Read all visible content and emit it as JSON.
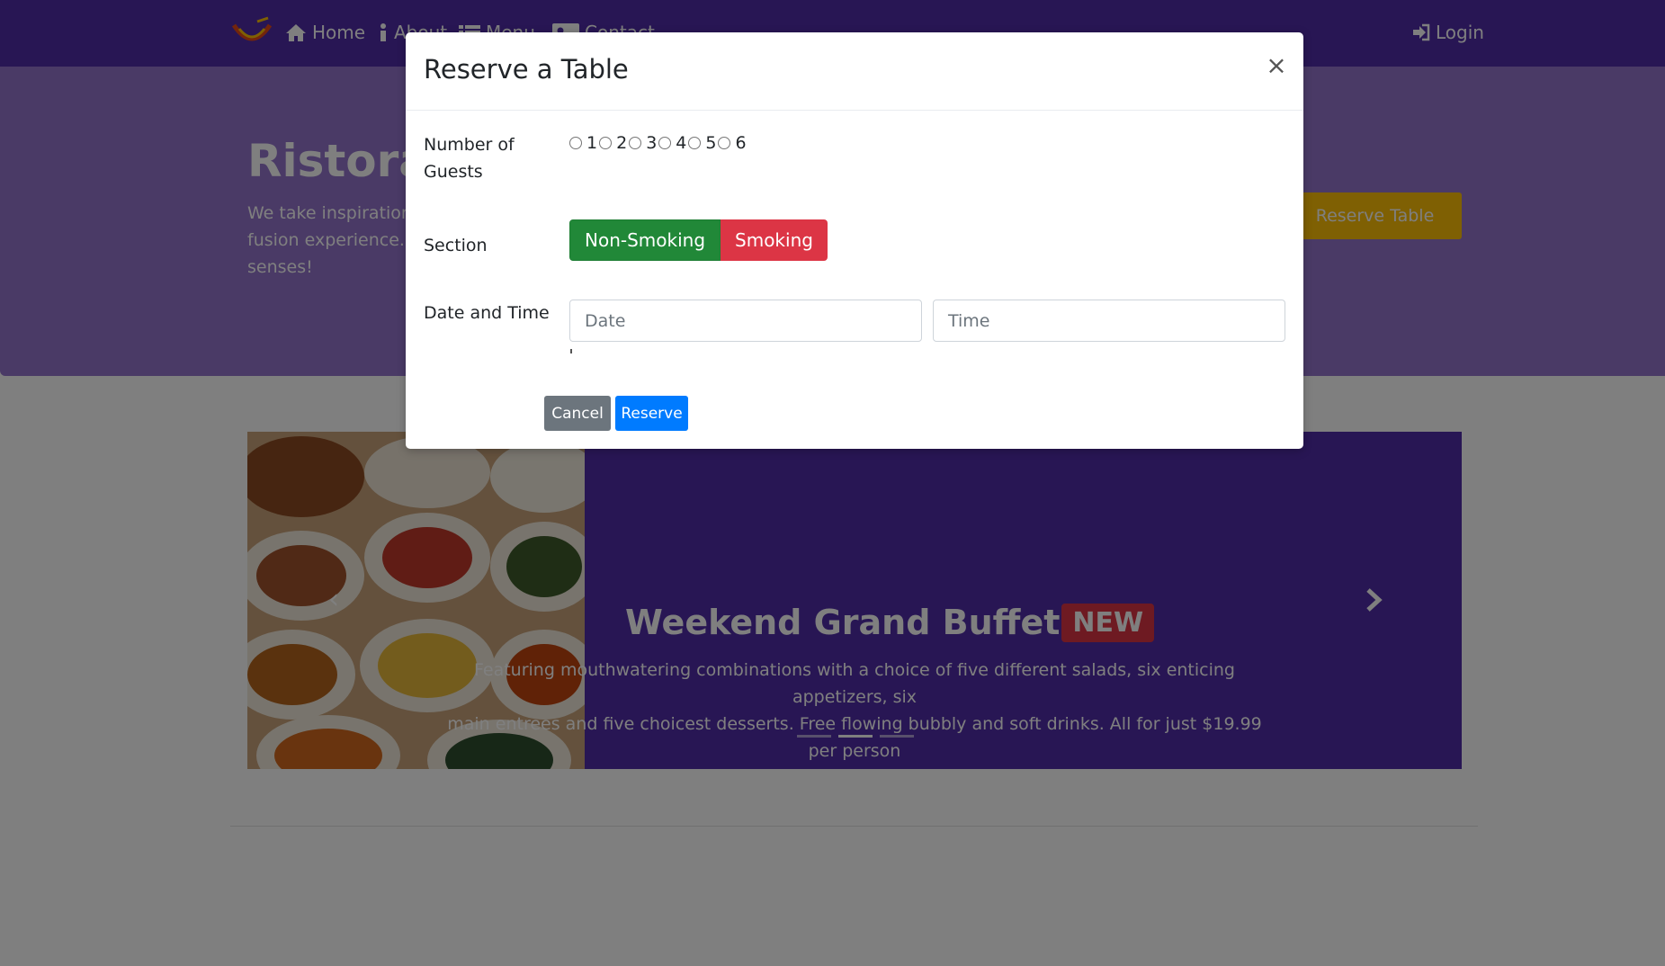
{
  "colors": {
    "navbar": "#512da8",
    "jumbotron": "#9575cd",
    "warning": "#ffc107",
    "success": "#218838",
    "danger": "#dc3545",
    "primary": "#007bff",
    "secondary": "#6c757d"
  },
  "navbar": {
    "logo_icon": "restaurant-logo",
    "items": [
      {
        "label": "Home",
        "icon": "home-icon"
      },
      {
        "label": "About",
        "icon": "info-icon"
      },
      {
        "label": "Menu",
        "icon": "list-icon"
      },
      {
        "label": "Contact",
        "icon": "address-card-icon"
      }
    ],
    "login_label": "Login"
  },
  "jumbotron": {
    "title": "Ristorante con Fusion",
    "lines": [
      "We take inspiration",
      "fusion experience. O",
      "senses!"
    ],
    "reserve_button": "Reserve Table"
  },
  "carousel": {
    "caption_title": "Weekend Grand Buffet",
    "badge": "NEW",
    "caption_line1": "Featuring mouthwatering combinations with a choice of five different salads, six enticing appetizers, six",
    "caption_line2": "main entrees and five choicest desserts. Free flowing bubbly and soft drinks. All for just $19.99 per person",
    "active_slide": 2,
    "slide_count": 3
  },
  "modal": {
    "title": "Reserve a Table",
    "close_glyph": "×",
    "guests_label_1": "Number of",
    "guests_label_2": "Guests",
    "guest_options": [
      "1",
      "2",
      "3",
      "4",
      "5",
      "6"
    ],
    "section_label": "Section",
    "section_options": [
      "Non-Smoking",
      "Smoking"
    ],
    "datetime_label": "Date and Time",
    "date_placeholder": "Date",
    "time_placeholder": "Time",
    "cancel_label": "Cancel",
    "reserve_label": "Reserve"
  }
}
